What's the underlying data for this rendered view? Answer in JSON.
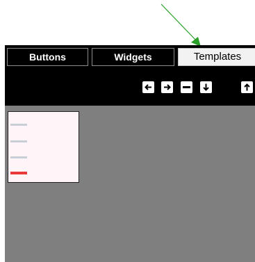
{
  "tabs": [
    {
      "label": "Buttons",
      "active": false
    },
    {
      "label": "Widgets",
      "active": false
    },
    {
      "label": "Templates",
      "active": true
    }
  ],
  "toolbar": {
    "buttons": [
      {
        "icon": "arrow-left-icon"
      },
      {
        "icon": "arrow-right-icon"
      },
      {
        "icon": "minus-icon"
      },
      {
        "icon": "arrow-down-icon"
      },
      {
        "icon": "arrow-up-icon"
      }
    ]
  },
  "colors": {
    "bar": "#000000",
    "canvas": "#7f7f7f",
    "active_tab": "#f2f2f2",
    "annotation_arrow": "#2aa02a",
    "card_bg": "#fff4f8",
    "card_red_line": "#e83a3a"
  }
}
